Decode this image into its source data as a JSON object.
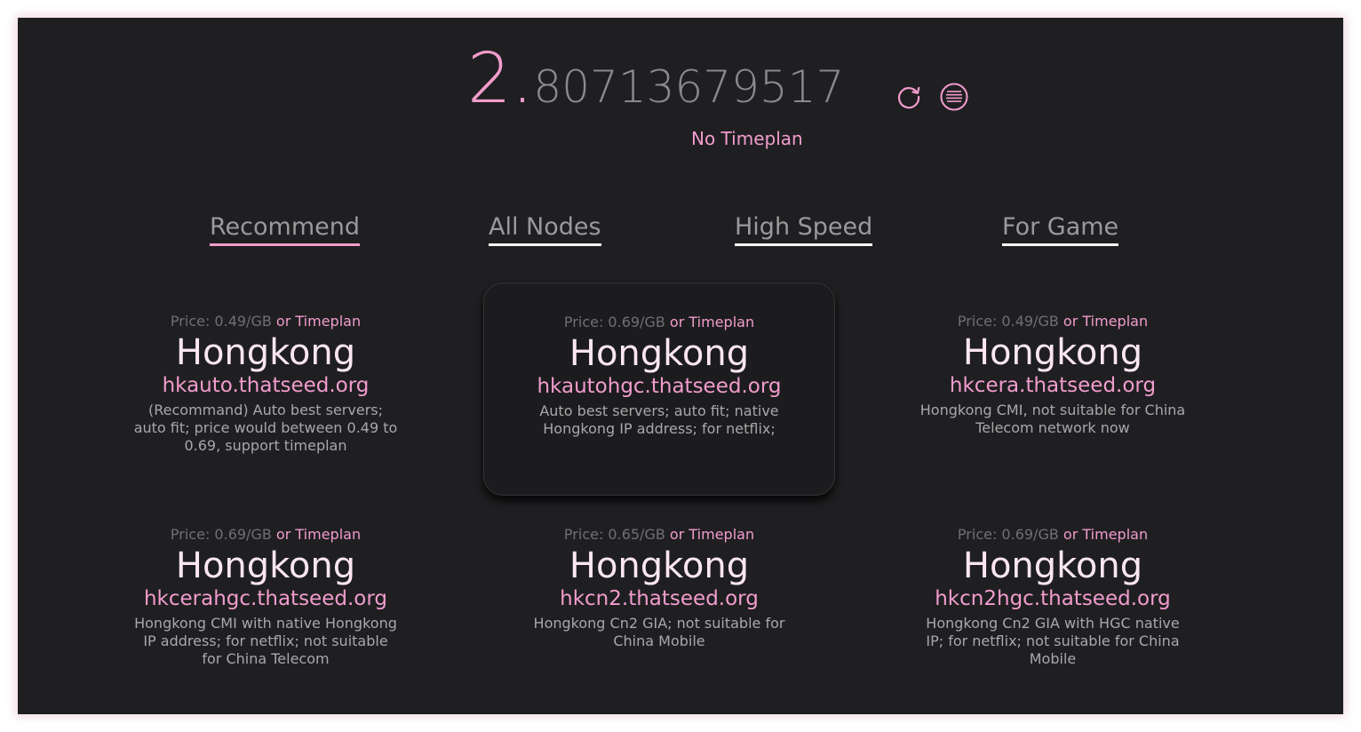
{
  "balance": {
    "integer": "2.",
    "fraction": "80713679517"
  },
  "timeplan_status": "No Timeplan",
  "icons": {
    "refresh": "refresh-icon",
    "menu": "menu-lines-icon"
  },
  "colors": {
    "accent": "#f29ccd",
    "background": "#1f1f21",
    "muted": "#8a8a8c"
  },
  "tabs": [
    {
      "label": "Recommend",
      "active": true
    },
    {
      "label": "All Nodes",
      "active": false
    },
    {
      "label": "High Speed",
      "active": false
    },
    {
      "label": "For Game",
      "active": false
    }
  ],
  "nodes": [
    {
      "price": "Price: 0.49/GB",
      "or_timeplan": "or Timeplan",
      "region": "Hongkong",
      "host": "hkauto.thatseed.org",
      "desc": "(Recommand) Auto best servers; auto fit; price would between 0.49 to 0.69, support timeplan"
    },
    {
      "price": "Price: 0.69/GB",
      "or_timeplan": "or Timeplan",
      "region": "Hongkong",
      "host": "hkautohgc.thatseed.org",
      "desc": "Auto best servers; auto fit; native Hongkong IP address; for netflix;"
    },
    {
      "price": "Price: 0.49/GB",
      "or_timeplan": "or Timeplan",
      "region": "Hongkong",
      "host": "hkcera.thatseed.org",
      "desc": "Hongkong CMI, not suitable for China Telecom network now"
    },
    {
      "price": "Price: 0.69/GB",
      "or_timeplan": "or Timeplan",
      "region": "Hongkong",
      "host": "hkcerahgc.thatseed.org",
      "desc": "Hongkong CMI with native Hongkong IP address; for netflix; not suitable for China Telecom"
    },
    {
      "price": "Price: 0.65/GB",
      "or_timeplan": "or Timeplan",
      "region": "Hongkong",
      "host": "hkcn2.thatseed.org",
      "desc": "Hongkong Cn2 GIA; not suitable for China Mobile"
    },
    {
      "price": "Price: 0.69/GB",
      "or_timeplan": "or Timeplan",
      "region": "Hongkong",
      "host": "hkcn2hgc.thatseed.org",
      "desc": "Hongkong Cn2 GIA with HGC native IP; for netflix; not suitable for China Mobile"
    }
  ]
}
